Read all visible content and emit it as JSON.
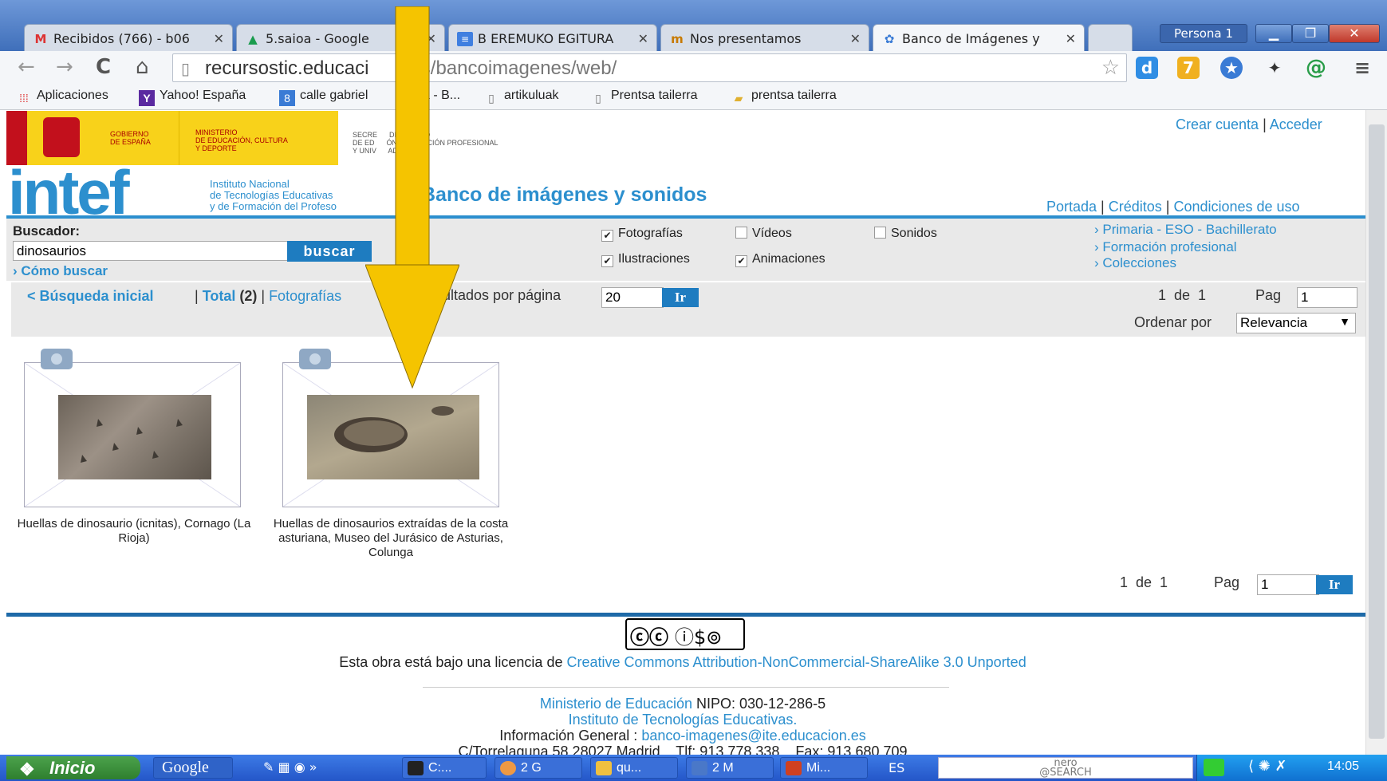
{
  "browser": {
    "tabs": [
      {
        "label": "Recibidos (766) - b06",
        "icon": "gmail-icon",
        "active": false
      },
      {
        "label": "5.saioa - Google",
        "icon": "drive-icon",
        "active": false
      },
      {
        "label": "B EREMUKO EGITURA",
        "icon": "docs-icon",
        "active": false
      },
      {
        "label": "Nos presentamos",
        "icon": "site-icon",
        "active": false
      },
      {
        "label": "Banco de Imágenes y",
        "icon": "puzzle-icon",
        "active": true
      }
    ],
    "persona": "Persona 1",
    "url_host": "recursostic.educaci",
    "url_path": "es/bancoimagenes/web/",
    "bookmarks": [
      {
        "label": "Aplicaciones",
        "icon": "apps-icon"
      },
      {
        "label": "Yahoo! España",
        "icon": "yahoo-icon"
      },
      {
        "label": "calle gabriel",
        "icon": "google-icon"
      },
      {
        "label": "ya - B...",
        "icon": "none"
      },
      {
        "label": "artikuluak",
        "icon": "page-icon"
      },
      {
        "label": "Prentsa tailerra",
        "icon": "page-icon"
      },
      {
        "label": "prentsa tailerra",
        "icon": "folder-icon"
      }
    ]
  },
  "header": {
    "gov_line1": "GOBIERNO\nDE ESPAÑA",
    "ministry": "MINISTERIO\nDE EDUCACIÓN, CULTURA\nY DEPORTE",
    "secretaria": "SECRE      DE ESTADO\nDE ED      ÓN, FORMACIÓN PROFESIONAL\nY UNIV      ADES",
    "logo": "intef",
    "logo_sub": "Instituto Nacional\nde Tecnologías Educativas\ny de Formación del Profeso",
    "site_title": "Banco de imágenes y sonidos",
    "crear_cuenta": "Crear cuenta",
    "acceder": "Acceder",
    "nav": [
      "Portada",
      "Créditos",
      "Condiciones de uso"
    ]
  },
  "search": {
    "label": "Buscador:",
    "value": "dinosaurios",
    "button": "buscar",
    "how": "Cómo buscar",
    "filters": [
      {
        "label": "Fotografías",
        "checked": true
      },
      {
        "label": "Vídeos",
        "checked": false
      },
      {
        "label": "Sonidos",
        "checked": false
      },
      {
        "label": "Ilustraciones",
        "checked": true
      },
      {
        "label": "Animaciones",
        "checked": true
      }
    ],
    "side_links": [
      "Primaria - ESO - Bachillerato",
      "Formación profesional",
      "Colecciones"
    ]
  },
  "results": {
    "back": "< Búsqueda inicial",
    "total_label": "Total",
    "total_count": "(2)",
    "fotografias": "Fotografías",
    "per_page_label": "esultados por página",
    "per_page": "20",
    "go": "Ir",
    "page_of": "1  de  1",
    "pag_label": "Pag",
    "page": "1",
    "order_label": "Ordenar por",
    "order_value": "Relevancia",
    "items": [
      {
        "caption": "Huellas de dinosaurio (icnitas), Cornago (La Rioja)"
      },
      {
        "caption": "Huellas de dinosaurios extraídas de la costa asturiana, Museo del Jurásico de Asturias, Colunga"
      }
    ]
  },
  "footer": {
    "license_text": "Esta obra está bajo una licencia de ",
    "license_link": "Creative Commons Attribution-NonCommercial-ShareAlike 3.0 Unported",
    "ministerio_link": "Ministerio de Educación",
    "nipo": " NIPO: 030-12-286-5",
    "instituto": "Instituto de Tecnologías Educativas.",
    "info_label": "Información General : ",
    "email": "banco-imagenes@ite.educacion.es",
    "address": "C/Torrelaguna 58 28027 Madrid    Tlf: 913 778 338    Fax: 913 680 709"
  },
  "taskbar": {
    "start": "Inicio",
    "google": "Google",
    "items": [
      "C:...",
      "2 G",
      "qu...",
      "2 M",
      "Mi..."
    ],
    "lang": "ES",
    "nero": "nero\n@SEARCH",
    "clock": "14:05"
  },
  "colors": {
    "accent": "#2c8fce",
    "arrow": "#f5c400"
  }
}
